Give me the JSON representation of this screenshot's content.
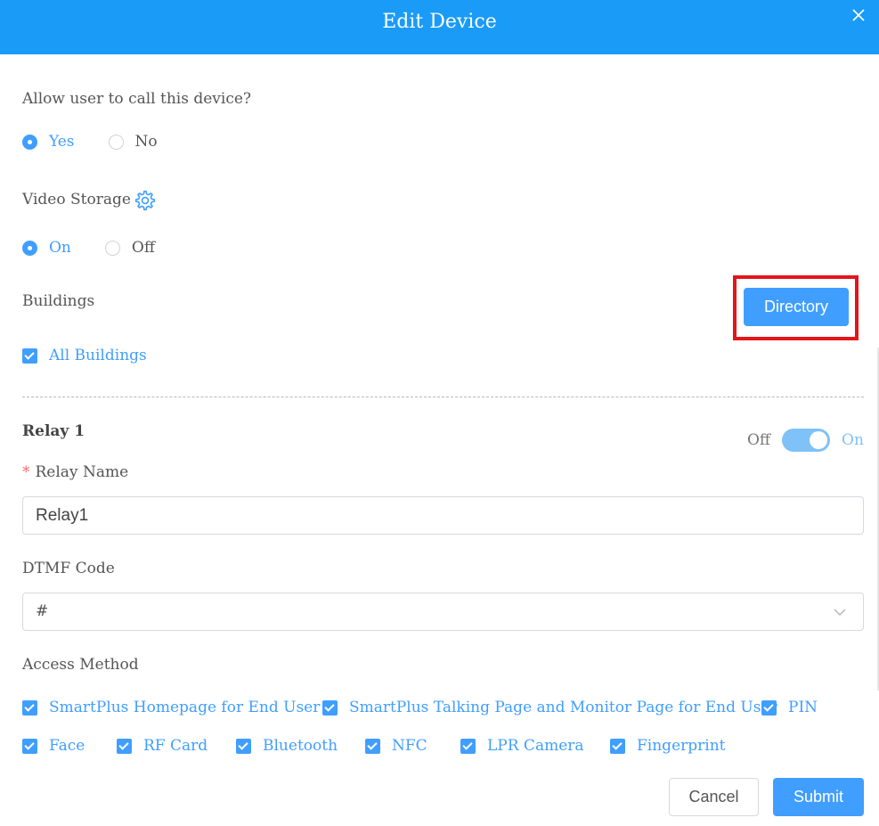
{
  "dialog": {
    "title": "Edit Device"
  },
  "call": {
    "label": "Allow user to call this device?",
    "options": [
      "Yes",
      "No"
    ],
    "selected": "Yes"
  },
  "video_storage": {
    "label": "Video Storage",
    "options": [
      "On",
      "Off"
    ],
    "selected": "On"
  },
  "buildings": {
    "label": "Buildings",
    "directory_button": "Directory",
    "all_buildings": "All Buildings",
    "all_buildings_checked": true
  },
  "relay": {
    "title": "Relay 1",
    "toggle_off": "Off",
    "toggle_on": "On",
    "enabled": true,
    "name_required_mark": "*",
    "name_label": "Relay Name",
    "name_value": "Relay1",
    "dtmf_label": "DTMF Code",
    "dtmf_value": "#"
  },
  "access": {
    "label": "Access Method",
    "methods": [
      "SmartPlus Homepage for End User",
      "SmartPlus Talking Page and Monitor Page for End User",
      "PIN",
      "Face",
      "RF Card",
      "Bluetooth",
      "NFC",
      "LPR Camera",
      "Fingerprint"
    ]
  },
  "footer": {
    "cancel": "Cancel",
    "submit": "Submit"
  },
  "colors": {
    "header": "#1a9bf7",
    "accent": "#409eff",
    "highlight": "#e0161b"
  }
}
